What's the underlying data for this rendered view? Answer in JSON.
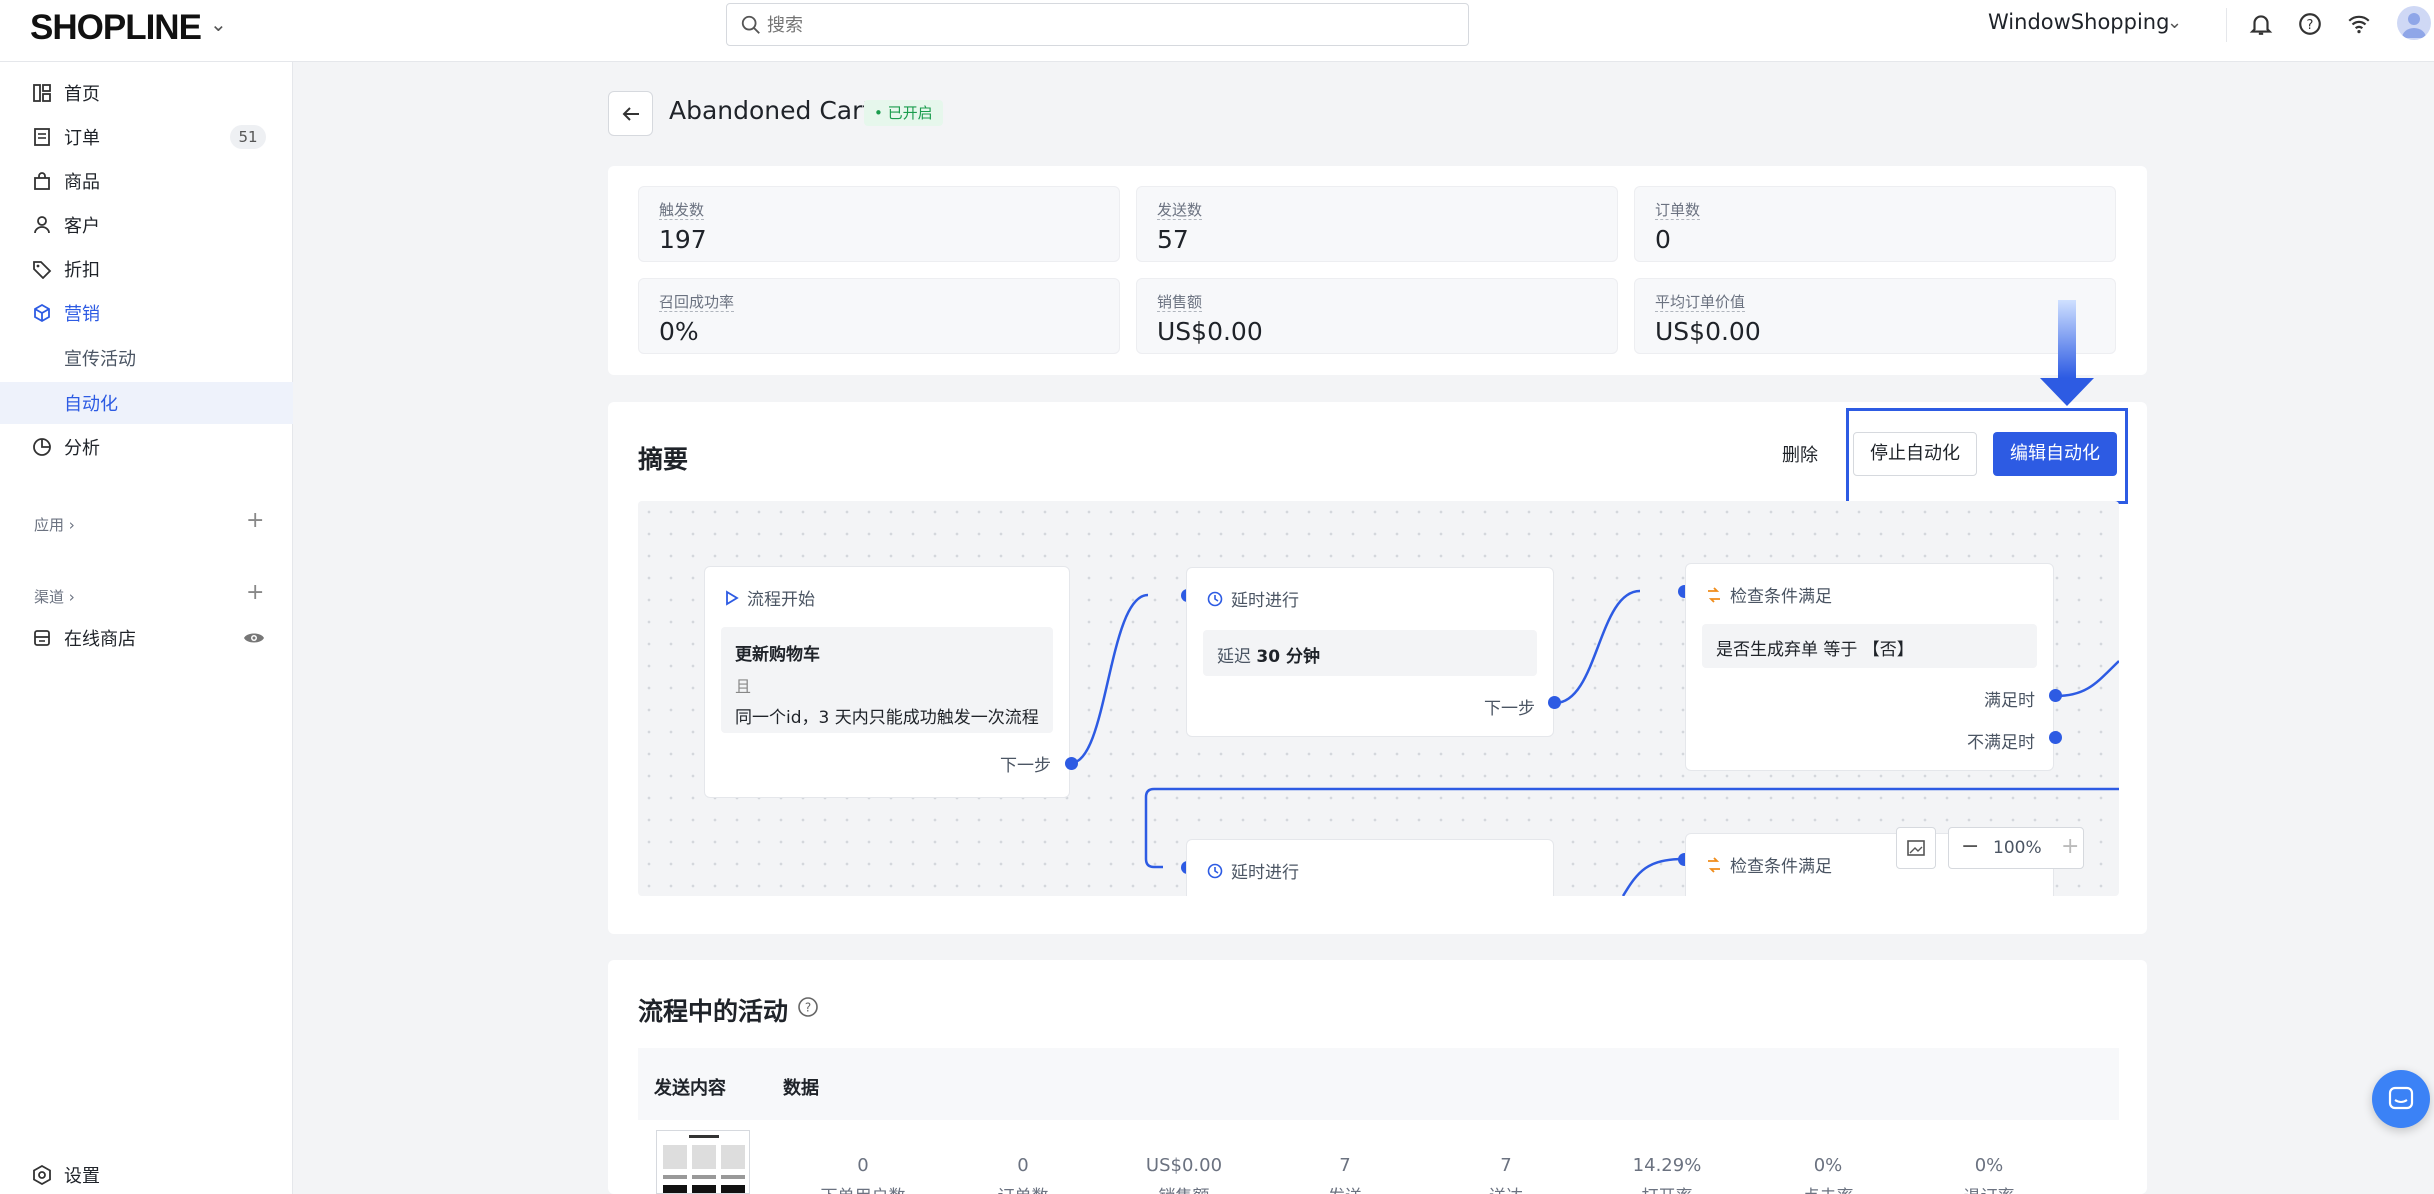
{
  "header": {
    "logo": "SHOPLINE",
    "search_placeholder": "搜索",
    "store_name": "WindowShopping"
  },
  "sidebar": {
    "items": [
      {
        "label": "首页",
        "icon": "home-icon"
      },
      {
        "label": "订单",
        "icon": "order-icon",
        "badge": "51"
      },
      {
        "label": "商品",
        "icon": "bag-icon"
      },
      {
        "label": "客户",
        "icon": "user-icon"
      },
      {
        "label": "折扣",
        "icon": "tag-icon"
      },
      {
        "label": "营销",
        "icon": "marketing-icon"
      },
      {
        "label": "宣传活动"
      },
      {
        "label": "自动化"
      },
      {
        "label": "分析",
        "icon": "analytics-icon"
      }
    ],
    "apps_label": "应用",
    "channels_label": "渠道",
    "online_store": "在线商店",
    "settings": "设置"
  },
  "page": {
    "title": "Abandoned Cart",
    "status": "已开启"
  },
  "stats": [
    {
      "label": "触发数",
      "value": "197"
    },
    {
      "label": "发送数",
      "value": "57"
    },
    {
      "label": "订单数",
      "value": "0"
    },
    {
      "label": "召回成功率",
      "value": "0%"
    },
    {
      "label": "销售额",
      "value": "US$0.00"
    },
    {
      "label": "平均订单价值",
      "value": "US$0.00"
    }
  ],
  "summary": {
    "title": "摘要",
    "delete_label": "删除",
    "stop_label": "停止自动化",
    "edit_label": "编辑自动化",
    "zoom": "100%",
    "flow": {
      "start_node": {
        "head": "流程开始",
        "title": "更新购物车",
        "and": "且",
        "rule": "同一个id，3 天内只能成功触发一次流程",
        "next": "下一步"
      },
      "delay_node": {
        "head": "延时进行",
        "body_prefix": "延迟",
        "body_value": "30 分钟",
        "next": "下一步"
      },
      "condition_node": {
        "head": "检查条件满足",
        "body": "是否生成弃单 等于 【否】",
        "yes": "满足时",
        "no": "不满足时"
      },
      "delay_node_2": {
        "head": "延时进行"
      },
      "condition_node_2": {
        "head": "检查条件满足"
      }
    }
  },
  "activities": {
    "title": "流程中的活动",
    "col_content": "发送内容",
    "col_data": "数据",
    "metrics": [
      {
        "value": "0",
        "label": "下单用户数"
      },
      {
        "value": "0",
        "label": "订单数"
      },
      {
        "value": "US$0.00",
        "label": "销售额"
      },
      {
        "value": "7",
        "label": "发送"
      },
      {
        "value": "7",
        "label": "送达"
      },
      {
        "value": "14.29%",
        "label": "打开率"
      },
      {
        "value": "0%",
        "label": "点击率"
      },
      {
        "value": "0%",
        "label": "退订率"
      }
    ]
  },
  "colors": {
    "accent": "#2d5be3",
    "status_green": "#1a9c4d",
    "condition_orange": "#f08c1a"
  }
}
